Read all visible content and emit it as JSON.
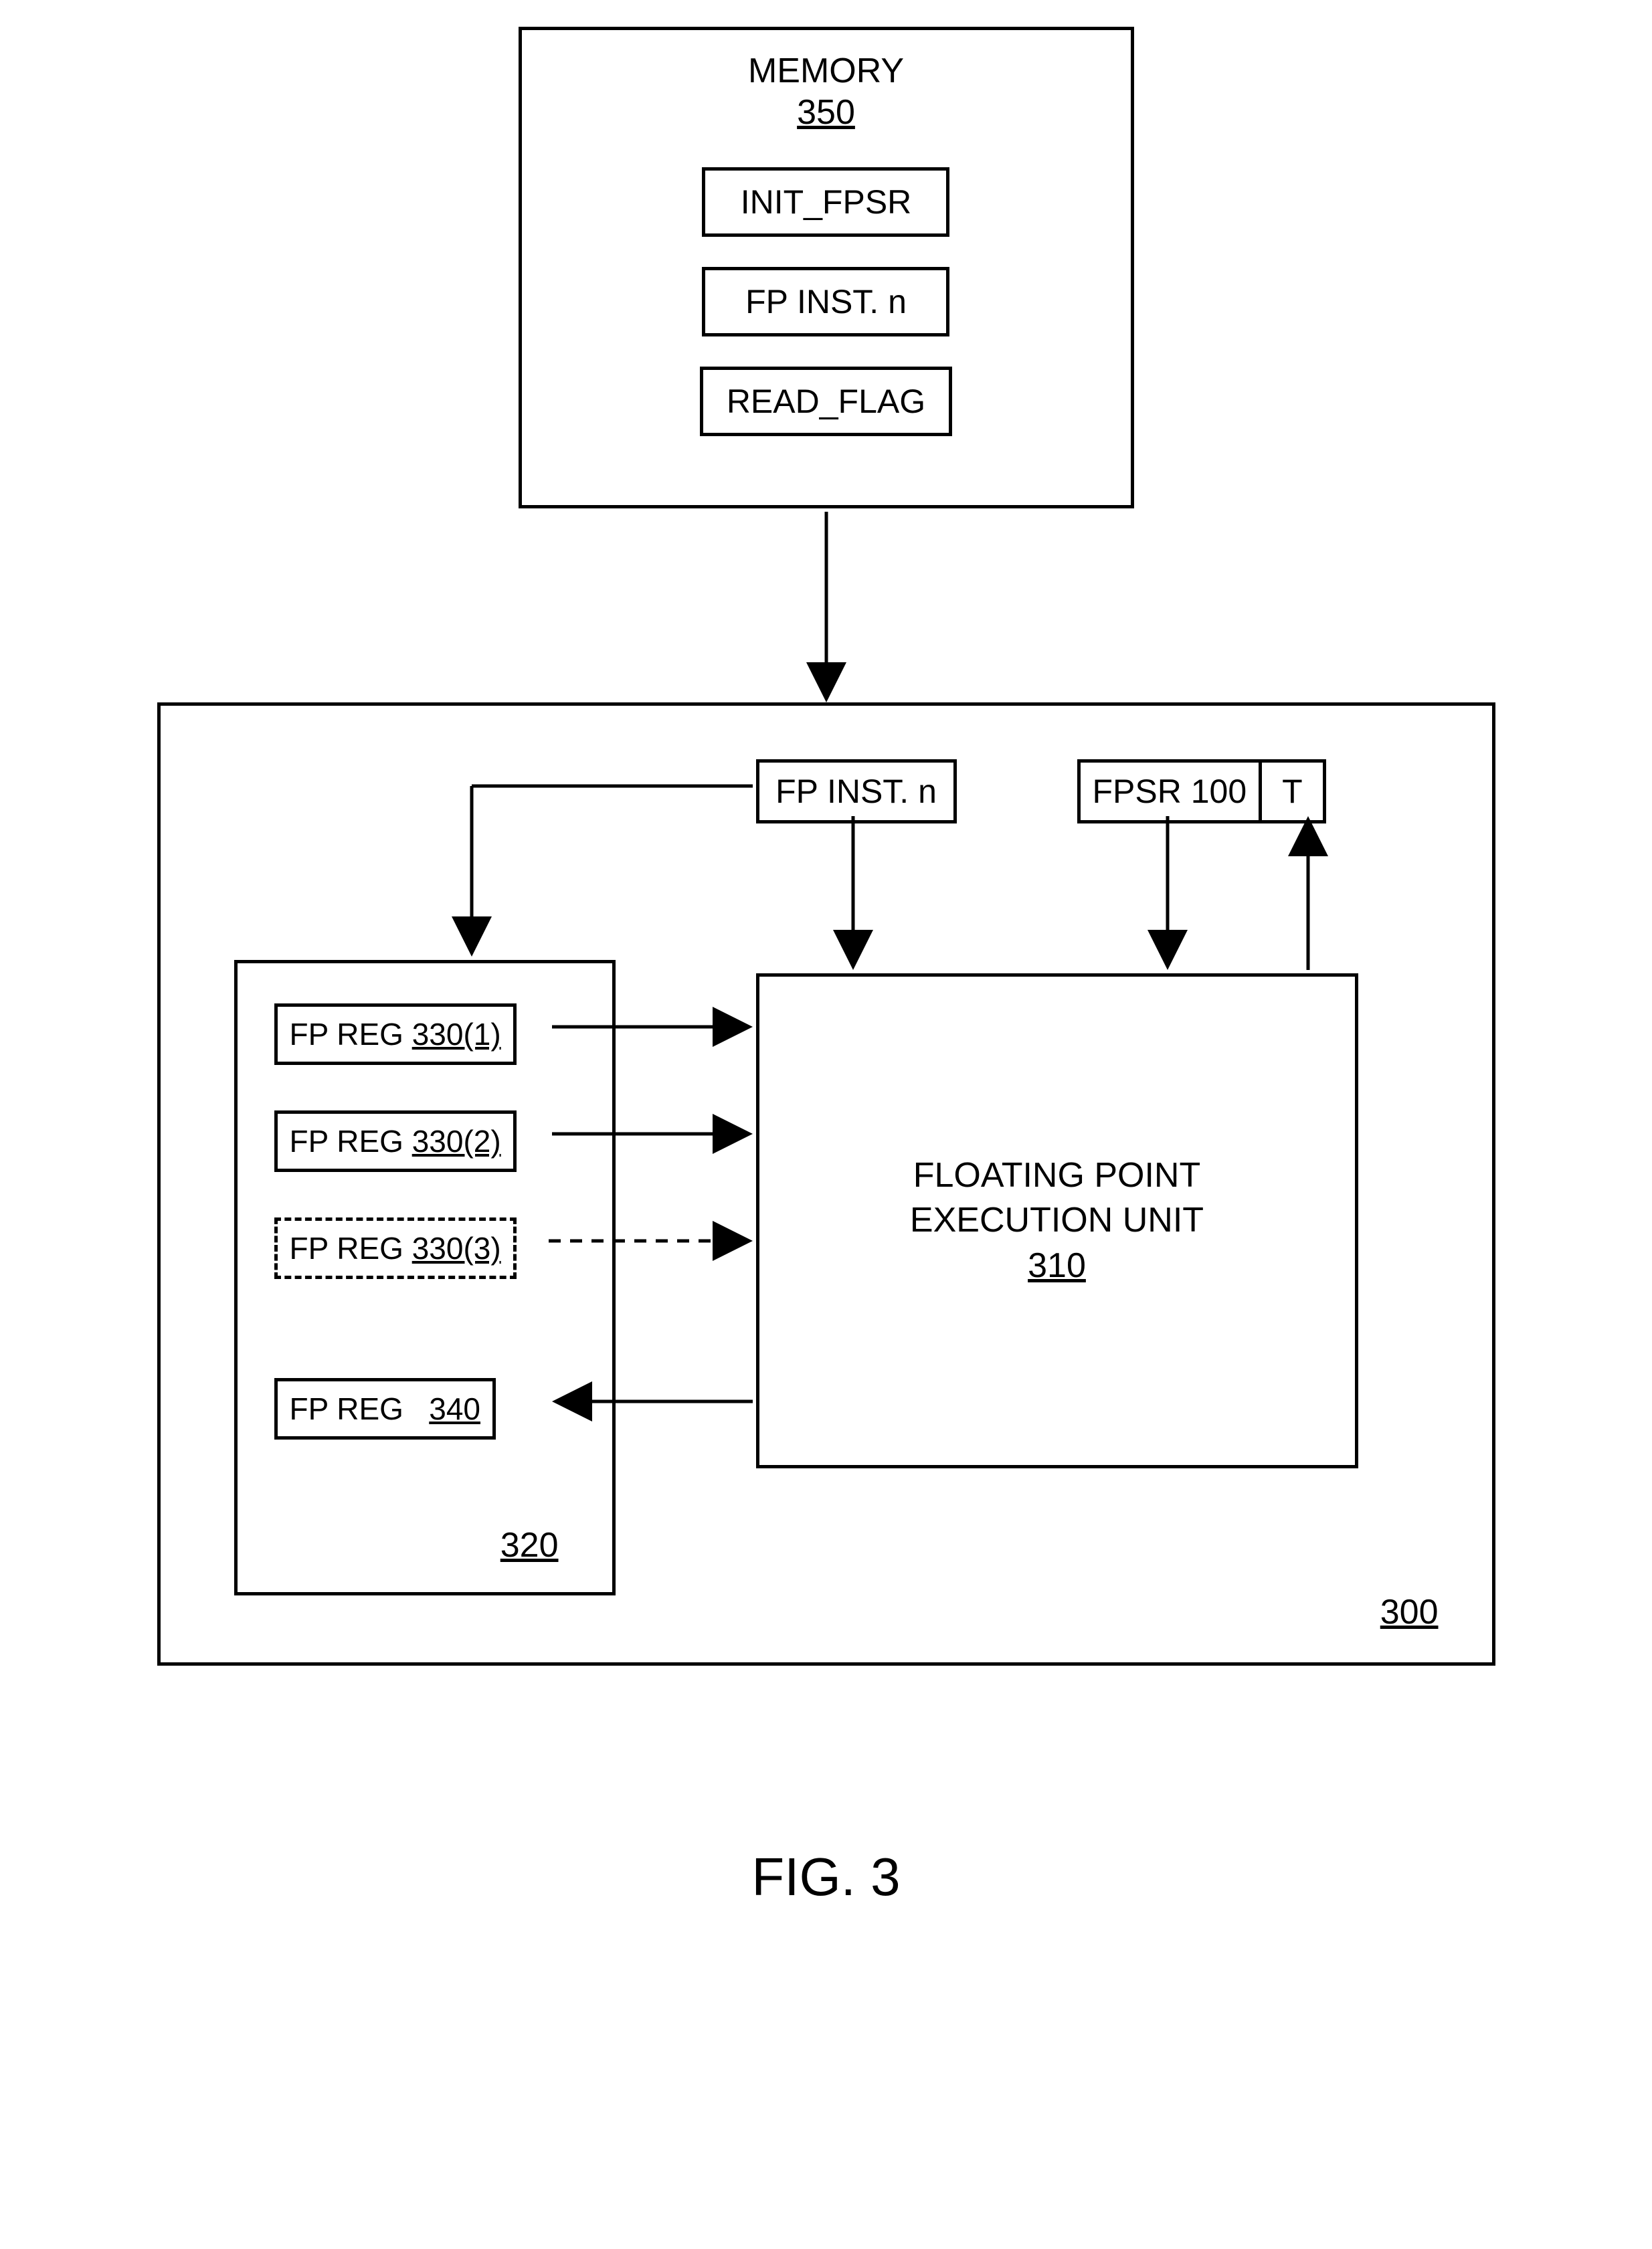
{
  "memory": {
    "title": "MEMORY",
    "id": "350",
    "items": [
      "INIT_FPSR",
      "FP INST. n",
      "READ_FLAG"
    ]
  },
  "processor": {
    "id": "300",
    "fp_inst_label": "FP INST. n",
    "fpsr_label": "FPSR 100",
    "t_label": "T",
    "reg_file": {
      "id": "320",
      "regs": [
        {
          "label": "FP REG",
          "id": "330(1)",
          "dashed": false
        },
        {
          "label": "FP REG",
          "id": "330(2)",
          "dashed": false
        },
        {
          "label": "FP REG",
          "id": "330(3)",
          "dashed": true
        },
        {
          "label": "FP REG",
          "id": "340",
          "dashed": false
        }
      ]
    },
    "fpu": {
      "title_line1": "FLOATING POINT",
      "title_line2": "EXECUTION UNIT",
      "id": "310"
    }
  },
  "figure_label": "FIG. 3"
}
